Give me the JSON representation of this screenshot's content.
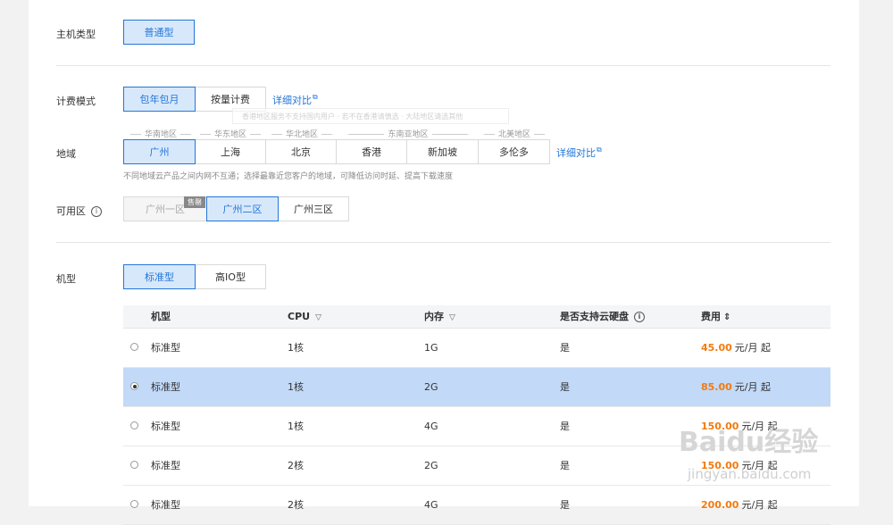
{
  "host_type": {
    "label": "主机类型",
    "option": "普通型"
  },
  "billing": {
    "label": "计费模式",
    "options": [
      "包年包月",
      "按量计费"
    ],
    "compare_link": "详细对比"
  },
  "region": {
    "label": "地域",
    "groups": [
      "华南地区",
      "华东地区",
      "华北地区",
      "东南亚地区",
      "北美地区"
    ],
    "options": [
      "广州",
      "上海",
      "北京",
      "香港",
      "新加坡",
      "多伦多"
    ],
    "compare_link": "详细对比",
    "hint": "不同地域云产品之间内网不互通；选择最靠近您客户的地域，可降低访问时延、提高下载速度",
    "tooltip_ghost": "香港地区服务不支持国内用户 · 若不在香港请慎选 · 大陆地区请选其他"
  },
  "zone": {
    "label": "可用区",
    "options": [
      "广州一区",
      "广州二区",
      "广州三区"
    ],
    "sold_out": "售罄"
  },
  "model": {
    "label": "机型",
    "options": [
      "标准型",
      "高IO型"
    ]
  },
  "table": {
    "headers": {
      "model": "机型",
      "cpu": "CPU",
      "mem": "内存",
      "disk": "是否支持云硬盘",
      "price": "费用"
    },
    "rows": [
      {
        "model": "标准型",
        "cpu": "1核",
        "mem": "1G",
        "disk": "是",
        "price": "45.00",
        "unit": "元/月 起"
      },
      {
        "model": "标准型",
        "cpu": "1核",
        "mem": "2G",
        "disk": "是",
        "price": "85.00",
        "unit": "元/月 起"
      },
      {
        "model": "标准型",
        "cpu": "1核",
        "mem": "4G",
        "disk": "是",
        "price": "150.00",
        "unit": "元/月 起"
      },
      {
        "model": "标准型",
        "cpu": "2核",
        "mem": "2G",
        "disk": "是",
        "price": "150.00",
        "unit": "元/月 起"
      },
      {
        "model": "标准型",
        "cpu": "2核",
        "mem": "4G",
        "disk": "是",
        "price": "200.00",
        "unit": "元/月 起"
      }
    ],
    "selected_row": 1
  },
  "watermark": {
    "brand": "Baidu经验",
    "url": "jingyan.baidu.com"
  },
  "colors": {
    "accent": "#2277da",
    "selected_bg": "#d8e8fb",
    "row_selected": "#c2d9f8",
    "price": "#f27b0e"
  }
}
